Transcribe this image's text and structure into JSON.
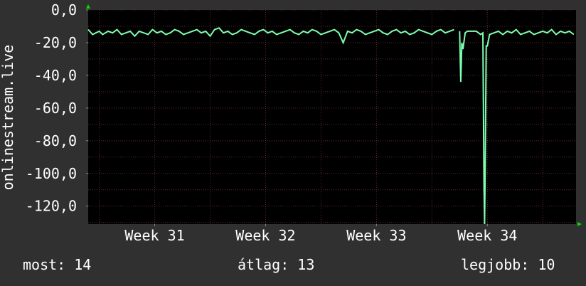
{
  "chart_data": {
    "type": "line",
    "ylabel": "onlinestream.live",
    "ylim": [
      -131,
      0
    ],
    "y_ticks": [
      0,
      -20,
      -40,
      -60,
      -80,
      -100,
      -120
    ],
    "y_tick_labels": [
      "0,0",
      "-20,0",
      "-40,0",
      "-60,0",
      "-80,0",
      "-100,0",
      "-120,0"
    ],
    "x_range": [
      30.4,
      34.8
    ],
    "x_ticks": [
      31,
      32,
      33,
      34
    ],
    "x_tick_labels": [
      "Week 31",
      "Week 32",
      "Week 33",
      "Week 34"
    ],
    "grid": true,
    "colors": {
      "background": "#303030",
      "plot_background": "#000000",
      "grid": "#5a2a2a",
      "line": "#7dffb0",
      "axis_arrow": "#00dd00"
    },
    "series": [
      {
        "x": [
          30.4,
          30.44,
          30.47,
          30.5,
          30.53,
          30.58,
          30.62,
          30.66,
          30.7,
          30.74,
          30.78,
          30.82,
          30.86,
          30.9,
          30.94,
          30.98,
          31.02,
          31.06,
          31.1,
          31.14,
          31.18,
          31.22,
          31.26,
          31.3,
          31.34,
          31.38,
          31.42,
          31.46,
          31.5,
          31.54,
          31.58,
          31.62,
          31.66,
          31.7,
          31.74,
          31.78,
          31.82,
          31.86,
          31.9,
          31.94,
          31.98,
          32.02,
          32.06,
          32.1,
          32.14,
          32.18,
          32.22,
          32.26,
          32.3,
          32.34,
          32.38,
          32.42,
          32.46,
          32.5,
          32.54,
          32.58,
          32.62,
          32.66,
          32.7,
          32.74,
          32.78,
          32.82,
          32.86,
          32.9,
          32.94,
          32.98,
          33.02,
          33.06,
          33.1,
          33.14,
          33.18,
          33.22,
          33.26,
          33.3,
          33.34,
          33.38,
          33.42,
          33.46,
          33.5,
          33.54,
          33.58,
          33.62,
          33.66,
          33.7,
          33.75,
          33.76,
          33.77,
          33.78,
          33.8,
          33.82,
          33.85,
          33.9,
          33.94,
          33.96,
          33.97,
          33.975,
          33.98,
          33.99,
          34.0,
          34.02,
          34.06,
          34.1,
          34.14,
          34.18,
          34.22,
          34.26,
          34.3,
          34.34,
          34.38,
          34.42,
          34.46,
          34.5,
          34.54,
          34.58,
          34.62,
          34.66,
          34.7,
          34.74,
          34.78
        ],
        "y": [
          -12,
          -15,
          -14,
          -13,
          -15,
          -13,
          -14,
          -12,
          -15,
          -14,
          -13,
          -16,
          -13,
          -14,
          -15,
          -12,
          -14,
          -13,
          -15,
          -14,
          -12,
          -13,
          -15,
          -14,
          -13,
          -12,
          -14,
          -13,
          -16,
          -12,
          -11,
          -14,
          -13,
          -15,
          -14,
          -12,
          -13,
          -14,
          -15,
          -13,
          -12,
          -14,
          -13,
          -15,
          -14,
          -13,
          -12,
          -14,
          -15,
          -13,
          -14,
          -12,
          -13,
          -15,
          -14,
          -13,
          -12,
          -14,
          -20,
          -13,
          -14,
          -12,
          -13,
          -15,
          -14,
          -13,
          -12,
          -14,
          -15,
          -13,
          -12,
          -14,
          -13,
          -15,
          -14,
          -12,
          -13,
          -14,
          -15,
          -13,
          -12,
          -14,
          -13,
          -12,
          -13,
          -44,
          -20,
          -24,
          -14,
          -13,
          -13,
          -13,
          -15,
          -14,
          -108,
          -131,
          -100,
          -22,
          -22,
          -15,
          -14,
          -13,
          -15,
          -13,
          -14,
          -12,
          -15,
          -14,
          -13,
          -15,
          -14,
          -13,
          -14,
          -12,
          -15,
          -13,
          -14,
          -13,
          -15
        ]
      }
    ]
  },
  "footer": {
    "current": "most: 14",
    "average": "átlag: 13",
    "best": "legjobb: 10"
  }
}
